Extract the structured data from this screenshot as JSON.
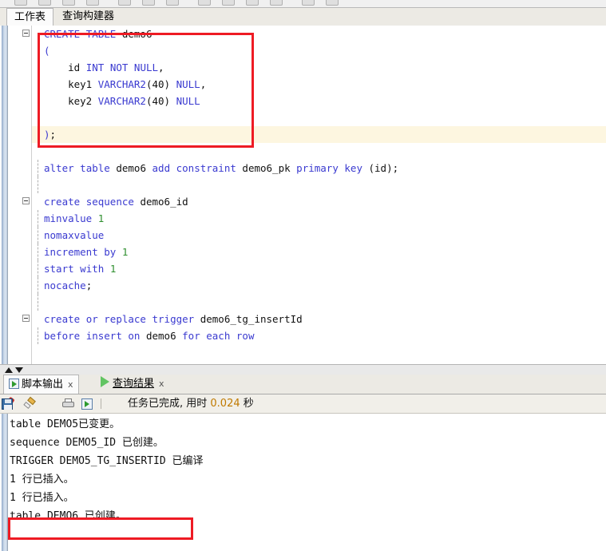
{
  "app_toolbar": {
    "icon_names": [
      "toolbar-icon-1",
      "toolbar-icon-2",
      "toolbar-icon-3",
      "toolbar-icon-4",
      "toolbar-icon-5",
      "toolbar-icon-6",
      "toolbar-icon-7",
      "toolbar-icon-8",
      "toolbar-icon-9"
    ]
  },
  "worksheet_tabs": [
    {
      "label": "工作表",
      "active": true
    },
    {
      "label": "查询构建器",
      "active": false
    }
  ],
  "editor": {
    "current_line_index": 6,
    "lines": [
      {
        "text": "CREATE TABLE demo6",
        "fold": true,
        "guide": false,
        "tokens": [
          {
            "t": "CREATE",
            "c": "kw"
          },
          {
            "t": " ",
            "c": "punc"
          },
          {
            "t": "TABLE",
            "c": "kw"
          },
          {
            "t": " ",
            "c": "punc"
          },
          {
            "t": "demo6",
            "c": "id"
          }
        ]
      },
      {
        "text": "(",
        "fold": false,
        "guide": true,
        "tokens": [
          {
            "t": "(",
            "c": "kw"
          }
        ]
      },
      {
        "text": "    id INT NOT NULL,",
        "fold": false,
        "guide": true,
        "tokens": [
          {
            "t": "    ",
            "c": "punc"
          },
          {
            "t": "id",
            "c": "id"
          },
          {
            "t": " ",
            "c": "punc"
          },
          {
            "t": "INT",
            "c": "kw"
          },
          {
            "t": " ",
            "c": "punc"
          },
          {
            "t": "NOT",
            "c": "kw"
          },
          {
            "t": " ",
            "c": "punc"
          },
          {
            "t": "NULL",
            "c": "kw"
          },
          {
            "t": ",",
            "c": "punc"
          }
        ]
      },
      {
        "text": "    key1 VARCHAR2(40) NULL,",
        "fold": false,
        "guide": true,
        "tokens": [
          {
            "t": "    ",
            "c": "punc"
          },
          {
            "t": "key1",
            "c": "id"
          },
          {
            "t": " ",
            "c": "punc"
          },
          {
            "t": "VARCHAR2",
            "c": "kw"
          },
          {
            "t": "(40)",
            "c": "punc"
          },
          {
            "t": " ",
            "c": "punc"
          },
          {
            "t": "NULL",
            "c": "kw"
          },
          {
            "t": ",",
            "c": "punc"
          }
        ]
      },
      {
        "text": "    key2 VARCHAR2(40) NULL",
        "fold": false,
        "guide": true,
        "tokens": [
          {
            "t": "    ",
            "c": "punc"
          },
          {
            "t": "key2",
            "c": "id"
          },
          {
            "t": " ",
            "c": "punc"
          },
          {
            "t": "VARCHAR2",
            "c": "kw"
          },
          {
            "t": "(40)",
            "c": "punc"
          },
          {
            "t": " ",
            "c": "punc"
          },
          {
            "t": "NULL",
            "c": "kw"
          }
        ]
      },
      {
        "text": "",
        "fold": false,
        "guide": true,
        "tokens": []
      },
      {
        "text": ");",
        "fold": false,
        "guide": true,
        "tokens": [
          {
            "t": ")",
            "c": "kw"
          },
          {
            "t": ";",
            "c": "punc"
          }
        ]
      },
      {
        "text": "",
        "fold": false,
        "guide": false,
        "tokens": []
      },
      {
        "text": "alter table demo6 add constraint demo6_pk primary key (id);",
        "fold": false,
        "guide": true,
        "tokens": [
          {
            "t": "alter",
            "c": "kw"
          },
          {
            "t": " ",
            "c": "punc"
          },
          {
            "t": "table",
            "c": "kw"
          },
          {
            "t": " ",
            "c": "punc"
          },
          {
            "t": "demo6",
            "c": "id"
          },
          {
            "t": " ",
            "c": "punc"
          },
          {
            "t": "add",
            "c": "kw"
          },
          {
            "t": " ",
            "c": "punc"
          },
          {
            "t": "constraint",
            "c": "kw"
          },
          {
            "t": " ",
            "c": "punc"
          },
          {
            "t": "demo6_pk",
            "c": "id"
          },
          {
            "t": " ",
            "c": "punc"
          },
          {
            "t": "primary",
            "c": "kw"
          },
          {
            "t": " ",
            "c": "punc"
          },
          {
            "t": "key",
            "c": "kw"
          },
          {
            "t": " ",
            "c": "punc"
          },
          {
            "t": "(id);",
            "c": "punc"
          }
        ]
      },
      {
        "text": "",
        "fold": false,
        "guide": true,
        "tokens": []
      },
      {
        "text": "create sequence demo6_id",
        "fold": true,
        "guide": false,
        "tokens": [
          {
            "t": "create",
            "c": "kw"
          },
          {
            "t": " ",
            "c": "punc"
          },
          {
            "t": "sequence",
            "c": "kw"
          },
          {
            "t": " ",
            "c": "punc"
          },
          {
            "t": "demo6_id",
            "c": "id"
          }
        ]
      },
      {
        "text": "minvalue 1",
        "fold": false,
        "guide": true,
        "tokens": [
          {
            "t": "minvalue",
            "c": "kw"
          },
          {
            "t": " ",
            "c": "punc"
          },
          {
            "t": "1",
            "c": "num"
          }
        ]
      },
      {
        "text": "nomaxvalue",
        "fold": false,
        "guide": true,
        "tokens": [
          {
            "t": "nomaxvalue",
            "c": "kw"
          }
        ]
      },
      {
        "text": "increment by 1",
        "fold": false,
        "guide": true,
        "tokens": [
          {
            "t": "increment",
            "c": "kw"
          },
          {
            "t": " ",
            "c": "punc"
          },
          {
            "t": "by",
            "c": "kw"
          },
          {
            "t": " ",
            "c": "punc"
          },
          {
            "t": "1",
            "c": "num"
          }
        ]
      },
      {
        "text": "start with 1",
        "fold": false,
        "guide": true,
        "tokens": [
          {
            "t": "start",
            "c": "kw"
          },
          {
            "t": " ",
            "c": "punc"
          },
          {
            "t": "with",
            "c": "kw"
          },
          {
            "t": " ",
            "c": "punc"
          },
          {
            "t": "1",
            "c": "num"
          }
        ]
      },
      {
        "text": "nocache;",
        "fold": false,
        "guide": true,
        "tokens": [
          {
            "t": "nocache",
            "c": "kw"
          },
          {
            "t": ";",
            "c": "punc"
          }
        ]
      },
      {
        "text": "",
        "fold": false,
        "guide": true,
        "tokens": []
      },
      {
        "text": "create or replace trigger demo6_tg_insertId",
        "fold": true,
        "guide": false,
        "tokens": [
          {
            "t": "create",
            "c": "kw"
          },
          {
            "t": " ",
            "c": "punc"
          },
          {
            "t": "or",
            "c": "kw"
          },
          {
            "t": " ",
            "c": "punc"
          },
          {
            "t": "replace",
            "c": "kw"
          },
          {
            "t": " ",
            "c": "punc"
          },
          {
            "t": "trigger",
            "c": "kw"
          },
          {
            "t": " ",
            "c": "punc"
          },
          {
            "t": "demo6_tg_insertId",
            "c": "id"
          }
        ]
      },
      {
        "text": "before insert on demo6 for each row",
        "fold": false,
        "guide": true,
        "tokens": [
          {
            "t": "before",
            "c": "kw"
          },
          {
            "t": " ",
            "c": "punc"
          },
          {
            "t": "insert",
            "c": "kw"
          },
          {
            "t": " ",
            "c": "punc"
          },
          {
            "t": "on",
            "c": "kw"
          },
          {
            "t": " ",
            "c": "punc"
          },
          {
            "t": "demo6",
            "c": "id"
          },
          {
            "t": " ",
            "c": "punc"
          },
          {
            "t": "for",
            "c": "kw"
          },
          {
            "t": " ",
            "c": "punc"
          },
          {
            "t": "each",
            "c": "kw"
          },
          {
            "t": " ",
            "c": "punc"
          },
          {
            "t": "row",
            "c": "kw"
          }
        ]
      }
    ]
  },
  "splitter": {
    "up_arrow": "collapse-up-arrow",
    "down_arrow": "collapse-down-arrow"
  },
  "output": {
    "tabs": [
      {
        "label": "脚本输出",
        "close": "x",
        "icon": "script-output-icon",
        "active": true
      },
      {
        "label": "查询结果",
        "close": "x",
        "icon": "run-query-icon",
        "active": false
      }
    ],
    "toolbar_icons": [
      {
        "name": "pin-icon"
      },
      {
        "name": "eraser-icon"
      },
      {
        "name": "save-icon"
      },
      {
        "name": "print-icon"
      },
      {
        "name": "script-output-icon"
      }
    ],
    "status_prefix": "任务已完成, 用时 ",
    "status_elapsed": "0.024",
    "status_suffix": " 秒",
    "lines": [
      "table DEMO5已变更。",
      "sequence DEMO5_ID 已创建。",
      "TRIGGER DEMO5_TG_INSERTID 已编译",
      "1 行已插入。",
      "1 行已插入。",
      "table DEMO6 已创建。"
    ],
    "highlighted_line_index": 5
  },
  "annotations": [
    {
      "name": "annotation-box-sql",
      "color": "#ee1b24"
    },
    {
      "name": "annotation-box-output",
      "color": "#ee1b24"
    }
  ]
}
